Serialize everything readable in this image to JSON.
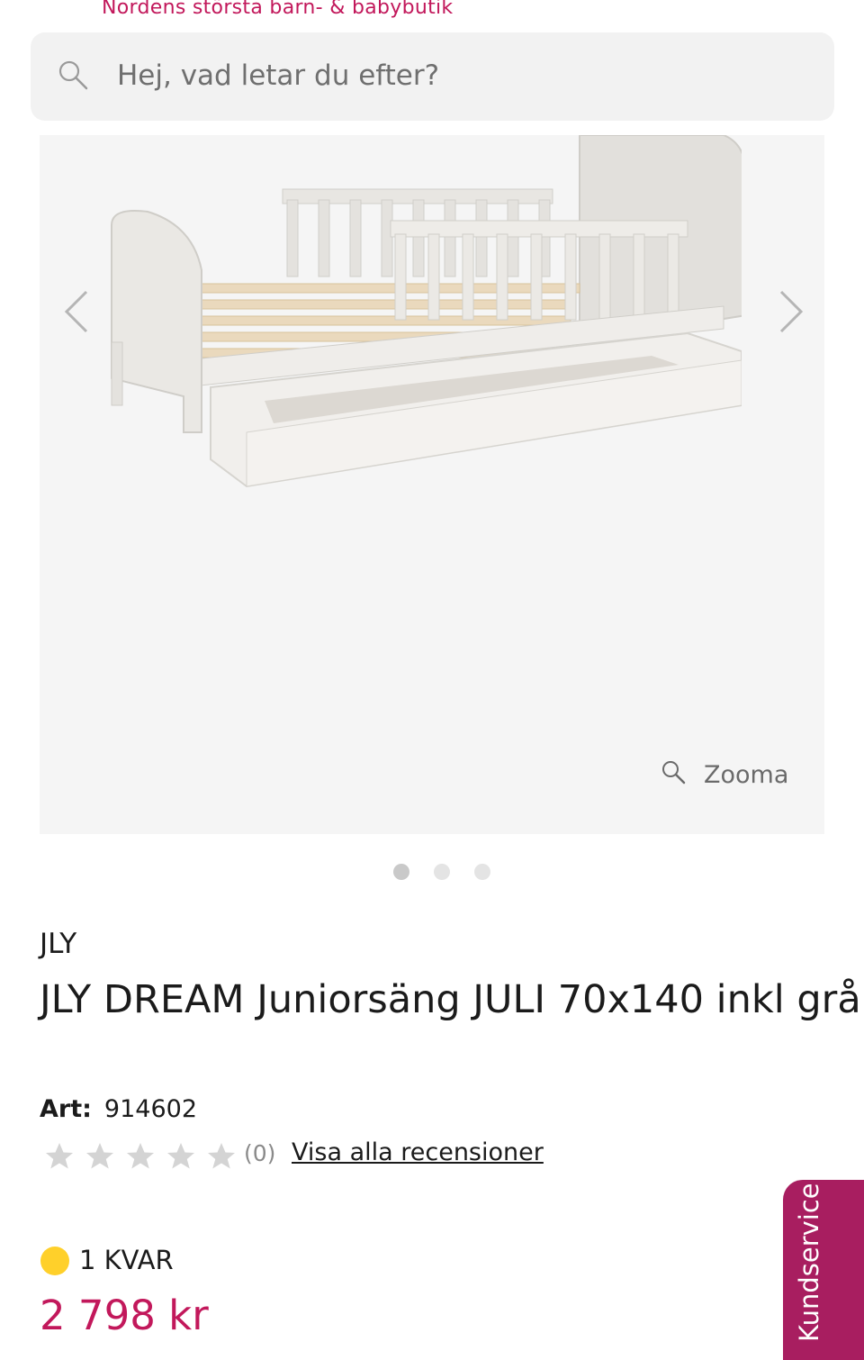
{
  "header": {
    "tagline": "Nordens största barn- & babybutik"
  },
  "search": {
    "placeholder": "Hej, vad letar du efter?",
    "icon": "search-icon"
  },
  "gallery": {
    "zoom_label": "Zooma",
    "slide_count": 3,
    "active_slide": 1
  },
  "product": {
    "brand": "JLY",
    "title": "JLY DREAM Juniorsäng JULI 70x140 inkl grå",
    "art_label": "Art:",
    "art_number": "914602",
    "rating": 0,
    "review_count": "(0)",
    "review_link": "Visa alla recensioner",
    "stock": "1 KVAR",
    "price": "2 798 kr"
  },
  "side_tab": {
    "label": "Kundservice"
  },
  "colors": {
    "brand_pink": "#c2185b",
    "service_tab": "#a81e60",
    "stock_dot": "#ffd02a"
  }
}
